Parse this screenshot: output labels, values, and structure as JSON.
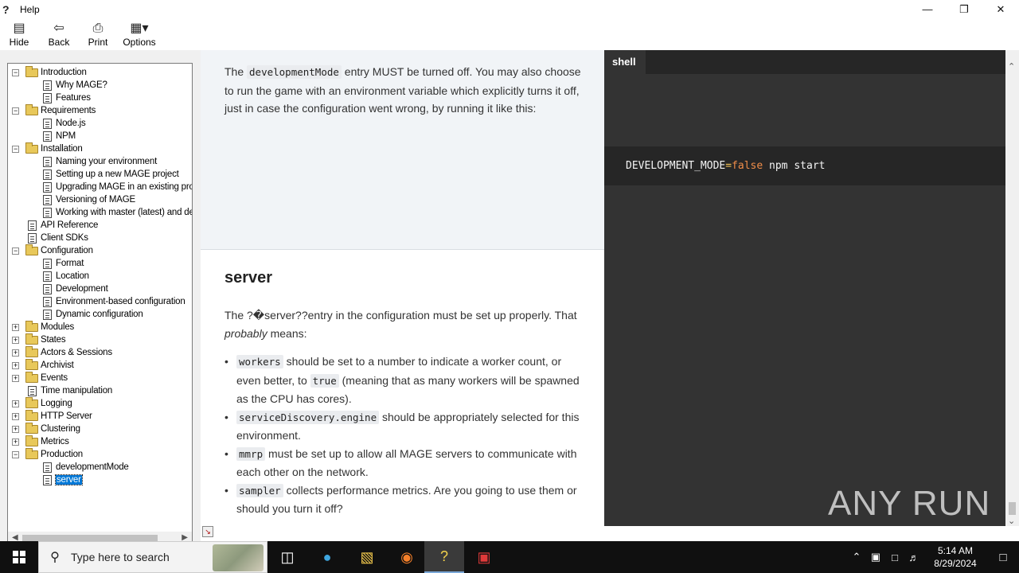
{
  "window": {
    "title": "Help"
  },
  "toolbar": [
    {
      "label": "Hide",
      "icon": "hide-icon"
    },
    {
      "label": "Back",
      "icon": "back-arrow-icon"
    },
    {
      "label": "Print",
      "icon": "printer-icon"
    },
    {
      "label": "Options",
      "icon": "options-icon"
    }
  ],
  "tree": [
    {
      "label": "Introduction",
      "level": 0,
      "type": "folder",
      "expander": "minus"
    },
    {
      "label": "Why MAGE?",
      "level": 1,
      "type": "page"
    },
    {
      "label": "Features",
      "level": 1,
      "type": "page"
    },
    {
      "label": "Requirements",
      "level": 0,
      "type": "folder",
      "expander": "minus"
    },
    {
      "label": "Node.js",
      "level": 1,
      "type": "page"
    },
    {
      "label": "NPM",
      "level": 1,
      "type": "page"
    },
    {
      "label": "Installation",
      "level": 0,
      "type": "folder",
      "expander": "minus"
    },
    {
      "label": "Naming your environment",
      "level": 1,
      "type": "page"
    },
    {
      "label": "Setting up a new MAGE project",
      "level": 1,
      "type": "page"
    },
    {
      "label": "Upgrading MAGE in an existing proj",
      "level": 1,
      "type": "page"
    },
    {
      "label": "Versioning of MAGE",
      "level": 1,
      "type": "page"
    },
    {
      "label": "Working with master (latest) and dev",
      "level": 1,
      "type": "page"
    },
    {
      "label": "API Reference",
      "level": 0,
      "type": "page"
    },
    {
      "label": "Client SDKs",
      "level": 0,
      "type": "page"
    },
    {
      "label": "Configuration",
      "level": 0,
      "type": "folder",
      "expander": "minus"
    },
    {
      "label": "Format",
      "level": 1,
      "type": "page"
    },
    {
      "label": "Location",
      "level": 1,
      "type": "page"
    },
    {
      "label": "Development",
      "level": 1,
      "type": "page"
    },
    {
      "label": "Environment-based configuration",
      "level": 1,
      "type": "page"
    },
    {
      "label": "Dynamic configuration",
      "level": 1,
      "type": "page"
    },
    {
      "label": "Modules",
      "level": 0,
      "type": "folder",
      "expander": "plus"
    },
    {
      "label": "States",
      "level": 0,
      "type": "folder",
      "expander": "plus"
    },
    {
      "label": "Actors & Sessions",
      "level": 0,
      "type": "folder",
      "expander": "plus"
    },
    {
      "label": "Archivist",
      "level": 0,
      "type": "folder",
      "expander": "plus"
    },
    {
      "label": "Events",
      "level": 0,
      "type": "folder",
      "expander": "plus"
    },
    {
      "label": "Time manipulation",
      "level": 0,
      "type": "page"
    },
    {
      "label": "Logging",
      "level": 0,
      "type": "folder",
      "expander": "plus"
    },
    {
      "label": "HTTP Server",
      "level": 0,
      "type": "folder",
      "expander": "plus"
    },
    {
      "label": "Clustering",
      "level": 0,
      "type": "folder",
      "expander": "plus"
    },
    {
      "label": "Metrics",
      "level": 0,
      "type": "folder",
      "expander": "plus"
    },
    {
      "label": "Production",
      "level": 0,
      "type": "folder",
      "expander": "minus"
    },
    {
      "label": "developmentMode",
      "level": 1,
      "type": "page"
    },
    {
      "label": "server",
      "level": 1,
      "type": "page",
      "selected": true
    }
  ],
  "content": {
    "para1": {
      "before": "The ",
      "code": "developmentMode",
      "after": " entry MUST be turned off. You may also choose to run the game with an environment variable which explicitly turns it off, just in case the configuration went wrong, by running it like this:"
    },
    "heading": "server",
    "para2": {
      "text": "The ?�server??entry in the configuration must be set up properly. That ",
      "em": "probably",
      "after": " means:"
    },
    "bullets": [
      {
        "code": "workers",
        "text": " should be set to a number to indicate a worker count, or even better, to ",
        "code2": "true",
        "text2": " (meaning that as many workers will be spawned as the CPU has cores)."
      },
      {
        "code": "serviceDiscovery.engine",
        "text": " should be appropriately selected for this environment."
      },
      {
        "code": "mmrp",
        "text": " must be set up to allow all MAGE servers to communicate with each other on the network."
      },
      {
        "code": "sampler",
        "text": " collects performance metrics. Are you going to use them or should you turn it off?"
      }
    ]
  },
  "shell": {
    "tab_label": "shell",
    "code": {
      "var": "DEVELOPMENT_MODE",
      "op": "=",
      "value": "false",
      "rest": " npm start"
    }
  },
  "watermark": "ANY RUN",
  "taskbar": {
    "search_placeholder": "Type here to search",
    "time": "5:14 AM",
    "date": "8/29/2024"
  }
}
